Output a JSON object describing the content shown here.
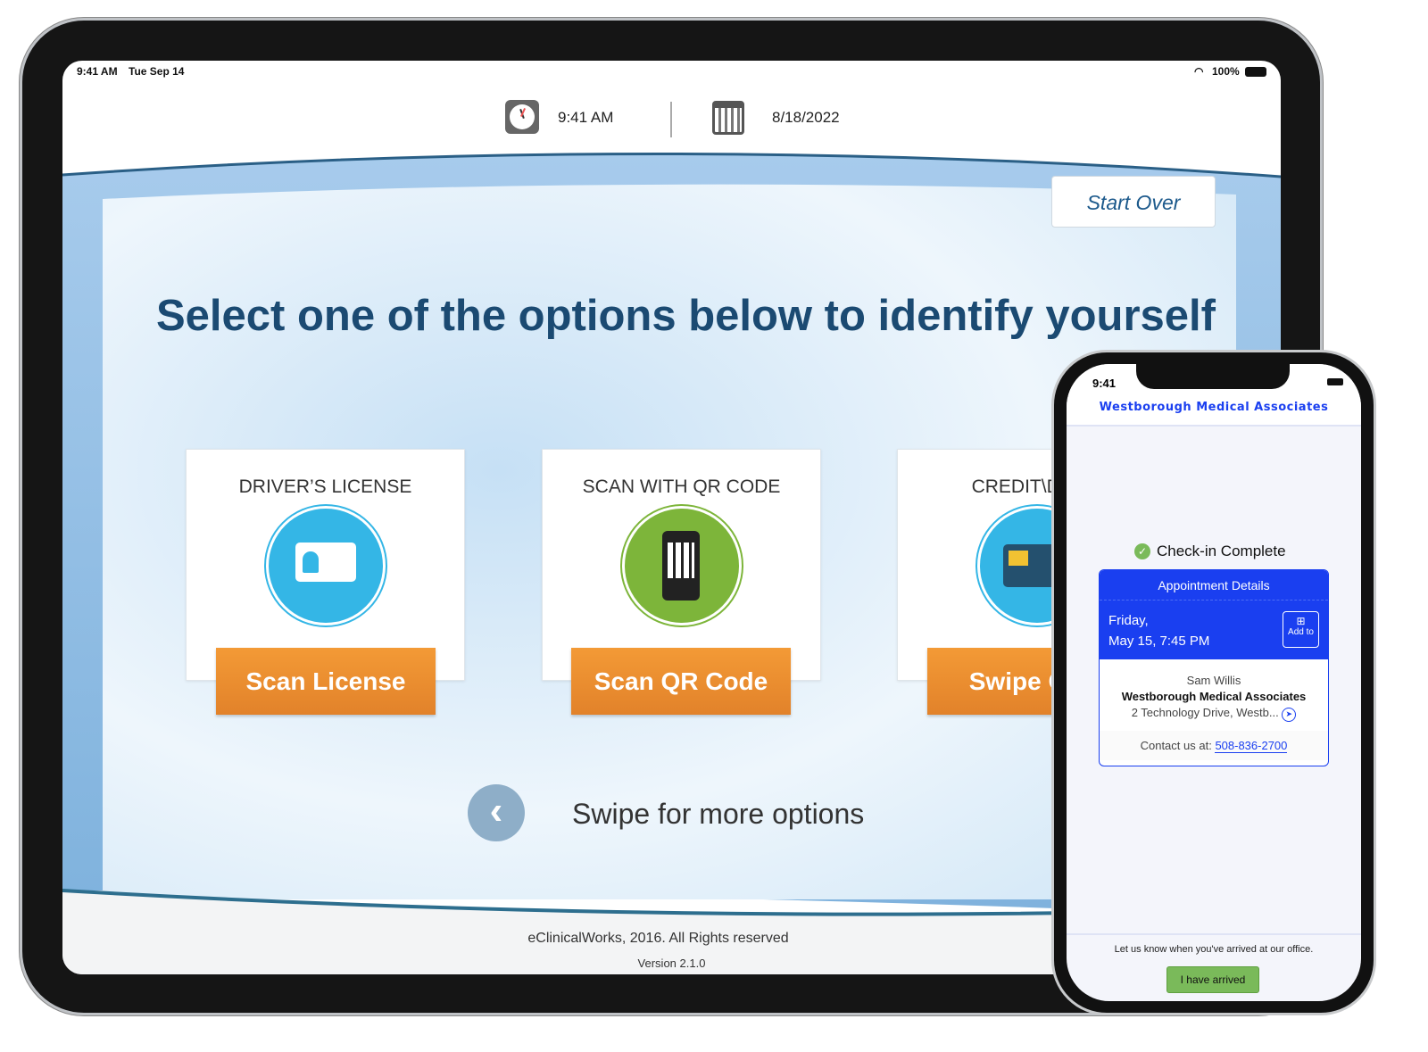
{
  "ipad": {
    "status_time": "9:41 AM",
    "status_date": "Tue Sep 14",
    "battery": "100%",
    "header": {
      "time": "9:41 AM",
      "date": "8/18/2022"
    },
    "start_over": "Start Over",
    "headline": "Select one of the options below to identify yourself",
    "cards": [
      {
        "title": "DRIVER’S LICENSE",
        "button": "Scan License",
        "icon": "id-card-icon",
        "color": "#34b6e6"
      },
      {
        "title": "SCAN WITH QR CODE",
        "button": "Scan QR Code",
        "icon": "phone-qr-icon",
        "color": "#7db53a"
      },
      {
        "title": "CREDIT\\DEBIT",
        "button": "Swipe Card",
        "icon": "credit-card-icon",
        "color": "#34b6e6"
      }
    ],
    "swipe_hint": "Swipe for more options",
    "footer": {
      "copyright": "eClinicalWorks, 2016. All Rights reserved",
      "version": "Version 2.1.0"
    },
    "colors": {
      "headline": "#1b4a72",
      "button": "#ea8a2e",
      "band": "#8dbbe3"
    }
  },
  "phone": {
    "status_time": "9:41",
    "title": "Westborough Medical Associates",
    "checkin": "Check-in Complete",
    "appointment": {
      "header": "Appointment Details",
      "day": "Friday,",
      "datetime": "May 15, 7:45 PM",
      "add_to": "Add to"
    },
    "provider": "Sam Willis",
    "practice": "Westborough Medical Associates",
    "address": "2 Technology Drive, Westb...",
    "contact_label": "Contact us at:",
    "phone_number": "508-836-2700",
    "arrival_prompt": "Let us know when you've arrived at our office.",
    "arrived_button": "I have arrived",
    "colors": {
      "accent": "#1a3ff0",
      "success": "#7aba5a"
    }
  }
}
